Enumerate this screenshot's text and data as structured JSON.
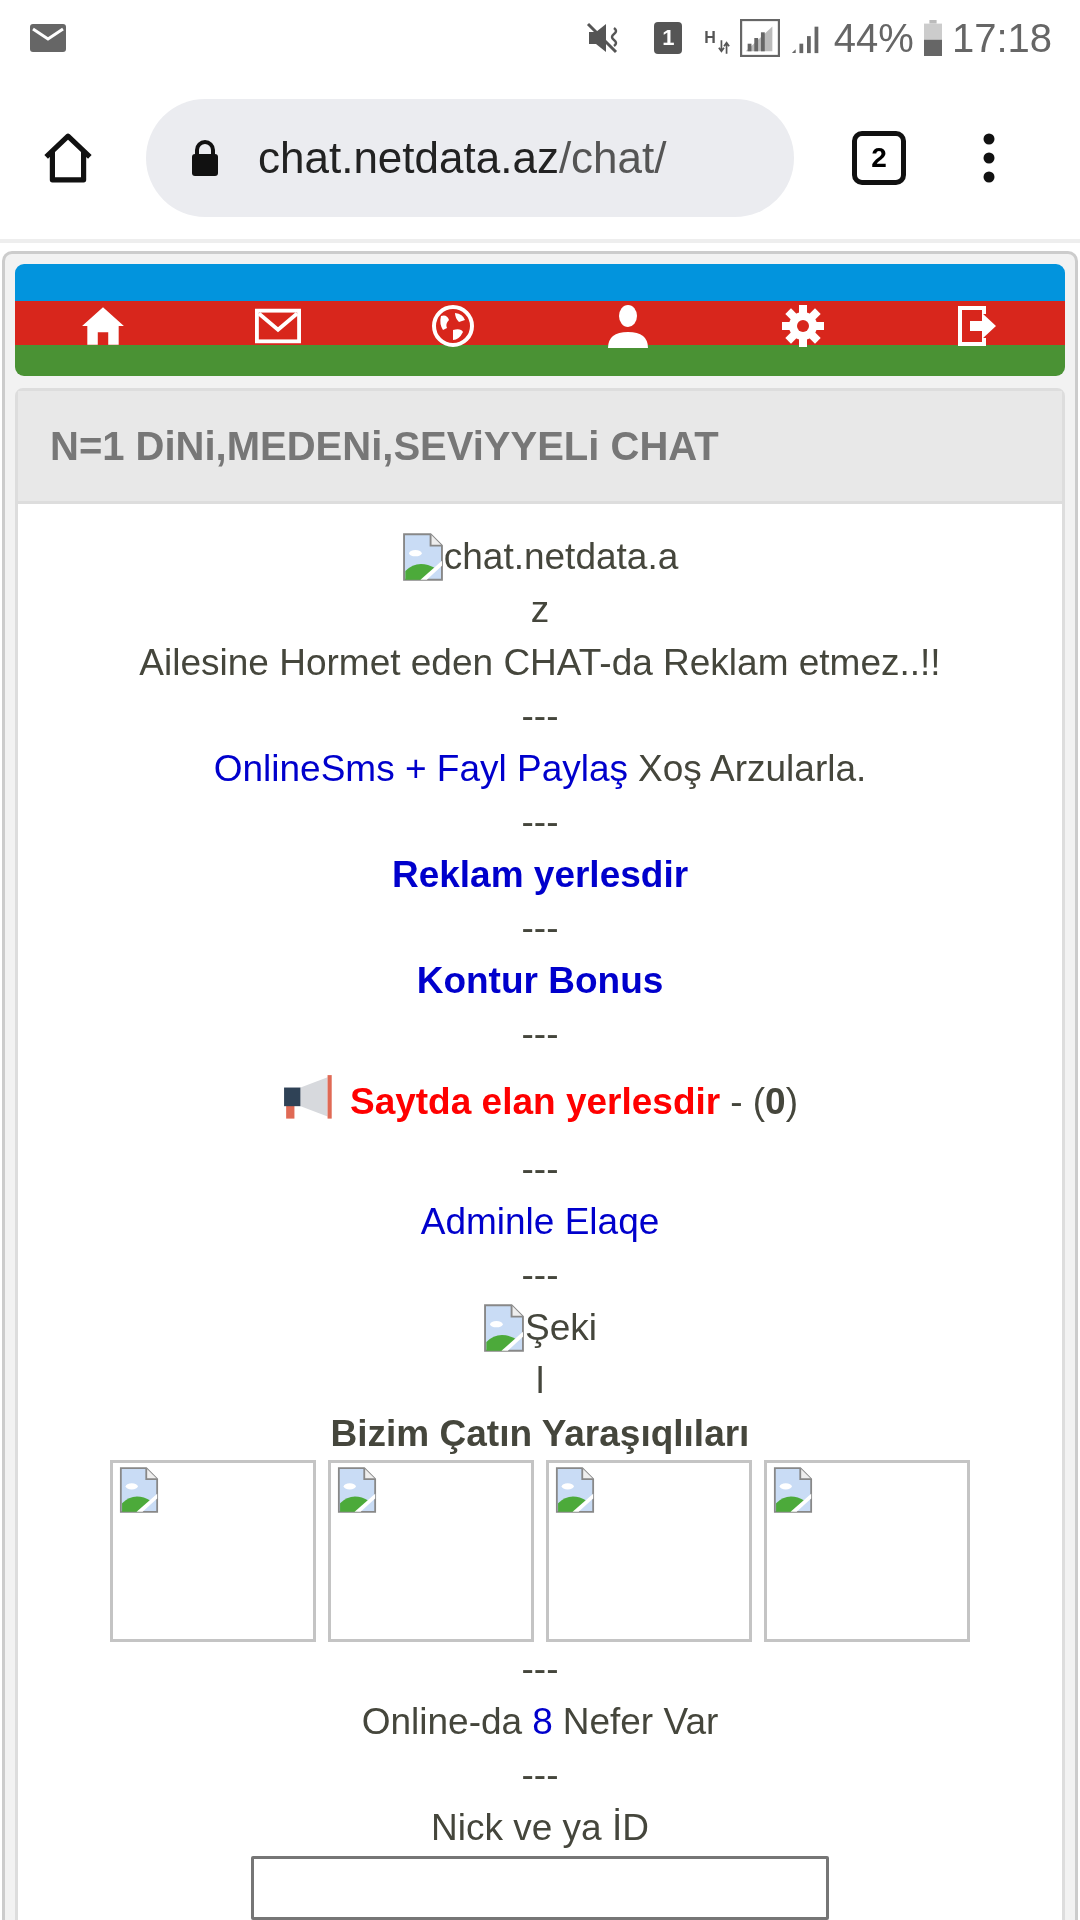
{
  "status_bar": {
    "sim_badge": "1",
    "network_type": "H",
    "battery": "44%",
    "time": "17:18"
  },
  "browser": {
    "url_host": "chat.netdata.az",
    "url_path": "/chat/",
    "tab_count": "2"
  },
  "page": {
    "title": "N=1 DiNi,MEDENi,SEViYYELi CHAT",
    "blocks": [
      {
        "kind": "broken_image",
        "lines": [
          "chat.netdata.a",
          "z"
        ]
      },
      {
        "kind": "text",
        "text": "Ailesine Hormet eden CHAT-da Reklam etmez..!!"
      },
      {
        "kind": "separator",
        "text": "---"
      },
      {
        "kind": "link_text",
        "link": "OnlineSms + Fayl Paylaş",
        "text": "Xoş Arzularla."
      },
      {
        "kind": "separator",
        "text": "---"
      },
      {
        "kind": "bold_link",
        "text": "Reklam yerlesdir"
      },
      {
        "kind": "separator",
        "text": "---"
      },
      {
        "kind": "bold_link",
        "text": "Kontur Bonus"
      },
      {
        "kind": "separator",
        "text": "---"
      },
      {
        "kind": "announce",
        "link": "Saytda elan yerlesdir",
        "text": "- (**0**)"
      },
      {
        "kind": "separator",
        "text": "---"
      },
      {
        "kind": "link",
        "text": "Adminle Elaqe"
      },
      {
        "kind": "separator",
        "text": "---"
      },
      {
        "kind": "broken_image",
        "lines": [
          "Şeki",
          "l"
        ]
      },
      {
        "kind": "heading",
        "text": "Bizim Çatın Yaraşıqlıları"
      },
      {
        "kind": "gallery",
        "frames": [
          {
            "kind": "broken_image"
          },
          {
            "kind": "broken_image"
          },
          {
            "kind": "broken_image"
          },
          {
            "kind": "broken_image"
          }
        ]
      },
      {
        "kind": "separator",
        "text": "---"
      },
      {
        "kind": "online",
        "before": "Online-da",
        "count": "8",
        "after": "Nefer Var"
      },
      {
        "kind": "separator",
        "text": "---"
      },
      {
        "kind": "label",
        "text": "Nick ve ya İD"
      },
      {
        "kind": "input"
      }
    ]
  }
}
